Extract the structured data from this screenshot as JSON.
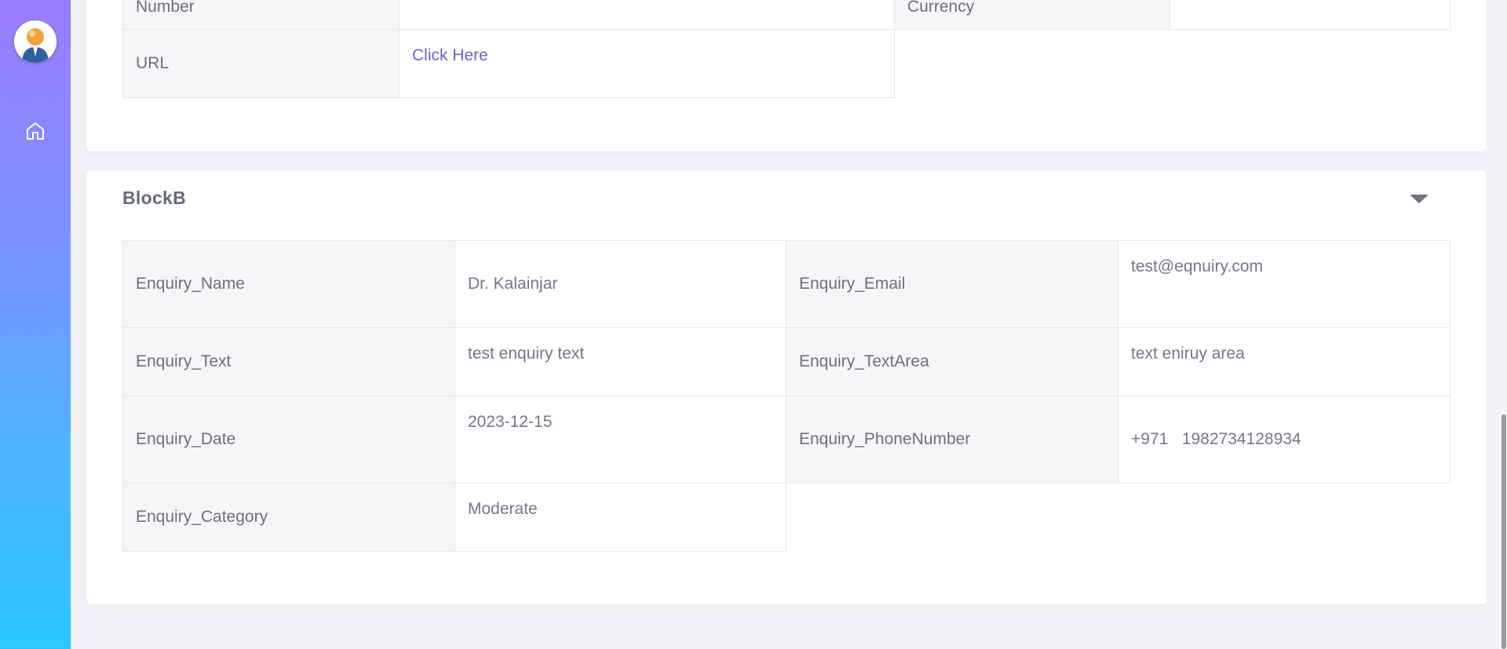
{
  "sidebar": {
    "avatar_icon": "user-avatar-icon",
    "home_icon": "home-icon"
  },
  "block_a": {
    "row_number": {
      "label": "Number",
      "value": "",
      "label2": "Currency",
      "value2": ""
    },
    "row_url": {
      "label": "URL",
      "value": "Click Here"
    }
  },
  "block_b": {
    "title": "BlockB",
    "toggle_icon": "caret-down-icon",
    "rows": [
      {
        "label": "Enquiry_Name",
        "value": "Dr.   Kalainjar",
        "label2": "Enquiry_Email",
        "value2": "test@eqnuiry.com"
      },
      {
        "label": "Enquiry_Text",
        "value": "test enquiry text",
        "label2": "Enquiry_TextArea",
        "value2": "text eniruy area"
      },
      {
        "label": "Enquiry_Date",
        "value": "2023-12-15",
        "label2": "Enquiry_PhoneNumber",
        "value2": "+971   1982734128934"
      },
      {
        "label": "Enquiry_Category",
        "value": "Moderate"
      }
    ]
  },
  "colors": {
    "sidebar_top": "#9a7cff",
    "sidebar_bottom": "#2bc8ff",
    "link": "#6a62cf"
  }
}
